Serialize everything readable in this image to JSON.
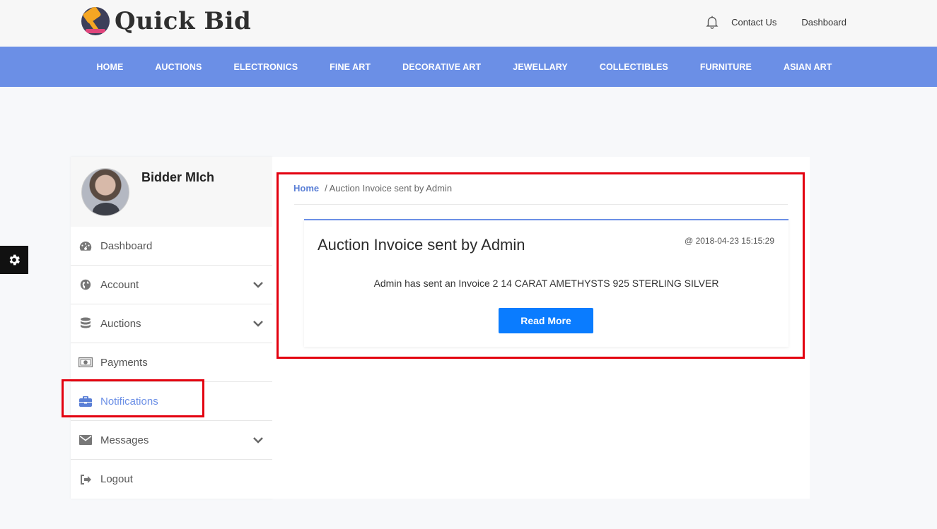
{
  "brand": {
    "name": "Quick Bid"
  },
  "top_links": {
    "contact": "Contact Us",
    "dashboard": "Dashboard"
  },
  "nav": [
    "HOME",
    "AUCTIONS",
    "ELECTRONICS",
    "FINE ART",
    "DECORATIVE ART",
    "JEWELLARY",
    "COLLECTIBLES",
    "FURNITURE",
    "ASIAN ART"
  ],
  "sidebar": {
    "username": "Bidder MIch",
    "items": [
      {
        "label": "Dashboard",
        "icon": "dashboard-icon",
        "has_chevron": false
      },
      {
        "label": "Account",
        "icon": "globe-icon",
        "has_chevron": true
      },
      {
        "label": "Auctions",
        "icon": "database-icon",
        "has_chevron": true
      },
      {
        "label": "Payments",
        "icon": "money-icon",
        "has_chevron": false
      },
      {
        "label": "Notifications",
        "icon": "briefcase-icon",
        "has_chevron": false,
        "active": true
      },
      {
        "label": "Messages",
        "icon": "envelope-icon",
        "has_chevron": true
      },
      {
        "label": "Logout",
        "icon": "logout-icon",
        "has_chevron": false
      }
    ]
  },
  "breadcrumb": {
    "home": "Home",
    "current": "/ Auction Invoice sent by Admin"
  },
  "notification": {
    "title": "Auction Invoice sent by Admin",
    "date": "@ 2018-04-23 15:15:29",
    "body": "Admin has sent an Invoice 2 14 CARAT AMETHYSTS 925 STERLING SILVER",
    "button": "Read More"
  },
  "colors": {
    "nav": "#6b8fe6",
    "button": "#0a7cff",
    "highlight": "#e3000f"
  }
}
